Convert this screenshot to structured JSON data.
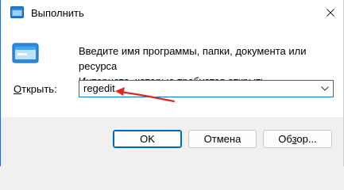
{
  "window": {
    "title": "Выполнить",
    "icon": "run-icon",
    "close_icon": "close-icon"
  },
  "description": {
    "line1": "Введите имя программы, папки, документа или ресурса",
    "line2": "Интернета, которые требуется открыть."
  },
  "open": {
    "label_prefix": "О",
    "label_rest": "ткрыть:",
    "value": "regedit",
    "dropdown_icon": "chevron-down-icon"
  },
  "annotation": {
    "arrow_color": "#e32620"
  },
  "buttons": {
    "ok_label": "OK",
    "cancel_label": "Отмена",
    "browse_prefix": "Об",
    "browse_underlined": "з",
    "browse_rest": "ор..."
  },
  "colors": {
    "accent": "#0078d4",
    "footer_bg": "#f0f0f0"
  }
}
